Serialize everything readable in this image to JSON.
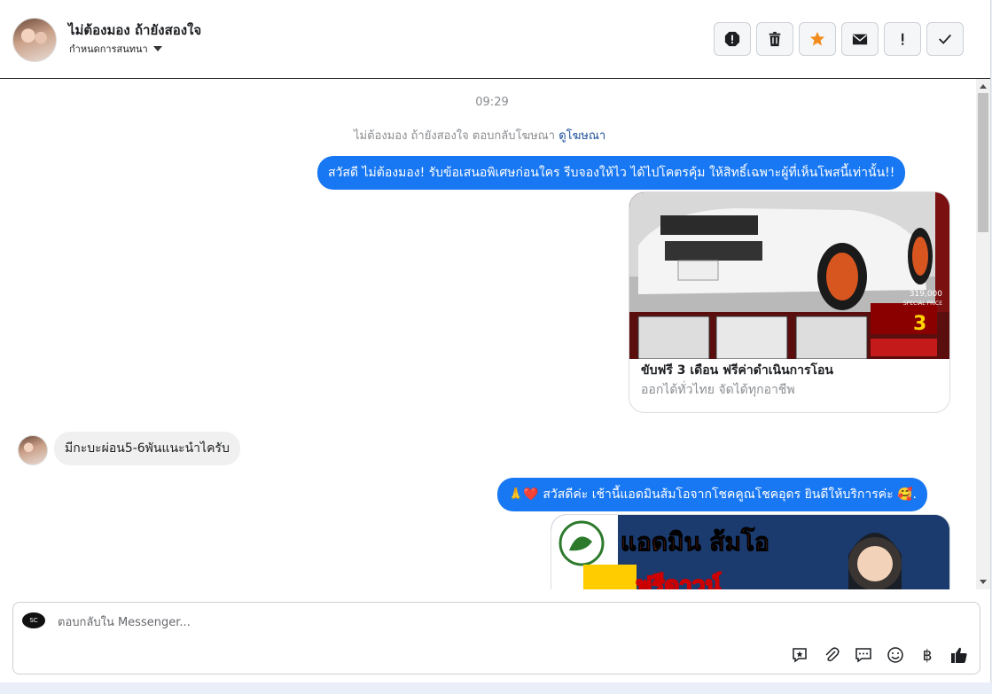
{
  "header": {
    "title": "ไม่ต้องมอง ถ้ายังสองใจ",
    "subtitle": "กำหนดการสนทนา",
    "actions": [
      {
        "name": "report-icon"
      },
      {
        "name": "trash-icon"
      },
      {
        "name": "star-icon"
      },
      {
        "name": "envelope-icon"
      },
      {
        "name": "exclamation-icon"
      },
      {
        "name": "check-icon"
      }
    ]
  },
  "chat": {
    "timestamp": "09:29",
    "ad_notice": "ไม่ต้องมอง ถ้ายังสองใจ ตอบกลับโฆษณา",
    "ad_link": "ดูโฆษณา",
    "message1": "สวัสดี ไม่ต้องมอง! รับข้อเสนอพิเศษก่อนใคร รีบจองให้ไว ได้ไปโคตรคุ้ม ให้สิทธิ์เฉพาะผู้ที่เห็นโพสนี้เท่านั้น!!",
    "card": {
      "price": "319,000",
      "price_label": "SPECIAL PRICE",
      "promo_big": "3",
      "title": "ขับฟรี 3 เดือน ฟรีค่าดำเนินการโอน",
      "subtitle": "ออกได้ทั่วไทย จัดได้ทุกอาชีพ"
    },
    "incoming": "มีกะบะผ่อน5-6พันแนะนำไครับ",
    "message2": "🙏❤️ สวัสดีค่ะ เช้านี้แอดมินส้มโอจากโชคคูณโชคอุดร ยินดีให้บริการค่ะ 🥰.",
    "promo_text": "แอดมิน ส้มโอ",
    "promo_text2": "ฟรีดาวน์"
  },
  "composer": {
    "placeholder": "ตอบกลับใน Messenger...",
    "page_badge": "SC",
    "tools": [
      "saved-reply-icon",
      "paperclip-icon",
      "chat-bubble-icon",
      "emoji-icon",
      "baht-icon",
      "thumbs-up-icon"
    ]
  },
  "colors": {
    "accent": "#1877f2",
    "star": "#f28c1d"
  }
}
